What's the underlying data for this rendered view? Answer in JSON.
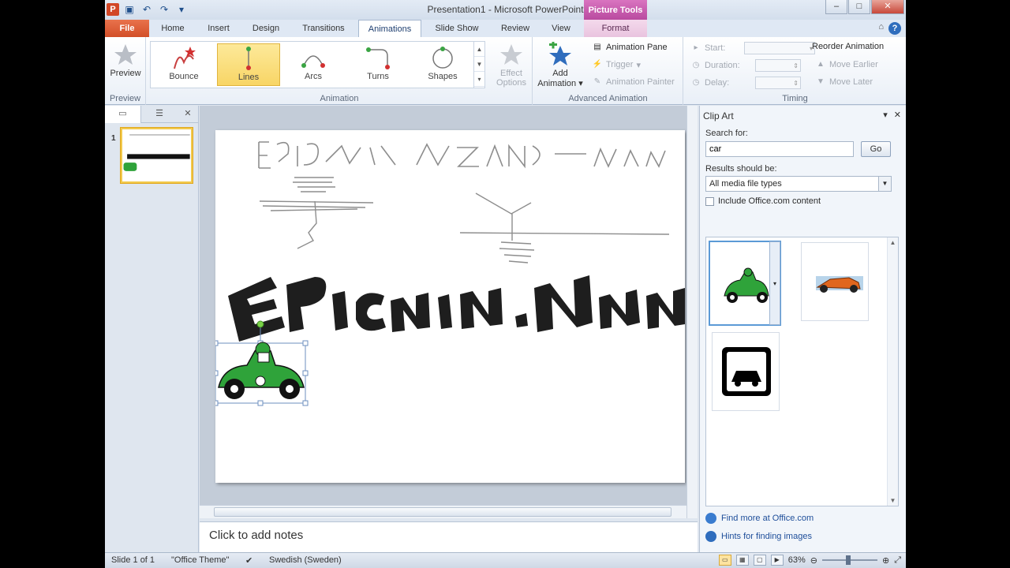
{
  "title_bar": {
    "title": "Presentation1 - Microsoft PowerPoint",
    "context_tools": "Picture Tools"
  },
  "tabs": [
    "File",
    "Home",
    "Insert",
    "Design",
    "Transitions",
    "Animations",
    "Slide Show",
    "Review",
    "View",
    "Format"
  ],
  "active_tab": "Animations",
  "ribbon": {
    "preview": {
      "button": "Preview",
      "group": "Preview"
    },
    "animation": {
      "group": "Animation",
      "gallery": [
        "Bounce",
        "Lines",
        "Arcs",
        "Turns",
        "Shapes"
      ],
      "selected": "Lines",
      "effect_options_1": "Effect",
      "effect_options_2": "Options"
    },
    "advanced": {
      "group": "Advanced Animation",
      "add_1": "Add",
      "add_2": "Animation",
      "pane": "Animation Pane",
      "trigger": "Trigger",
      "painter": "Animation Painter"
    },
    "timing": {
      "group": "Timing",
      "start": "Start:",
      "duration": "Duration:",
      "delay": "Delay:",
      "reorder": "Reorder Animation",
      "earlier": "Move Earlier",
      "later": "Move Later"
    }
  },
  "slides_pane": {
    "slide_number": "1"
  },
  "notes_placeholder": "Click to add notes",
  "clip_art": {
    "header": "Clip Art",
    "search_label": "Search for:",
    "search_value": "car",
    "go": "Go",
    "results_label": "Results should be:",
    "results_value": "All media file types",
    "include_label": "Include Office.com content",
    "link_more": "Find more at Office.com",
    "link_hints": "Hints for finding images"
  },
  "status_bar": {
    "slide_info": "Slide 1 of 1",
    "theme": "\"Office Theme\"",
    "language": "Swedish (Sweden)",
    "zoom": "63%"
  },
  "colors": {
    "file_tab": "#d24f28",
    "context_tab": "#c34fa8",
    "car_green": "#2fa33a",
    "selected_gallery": "#f8d565"
  }
}
